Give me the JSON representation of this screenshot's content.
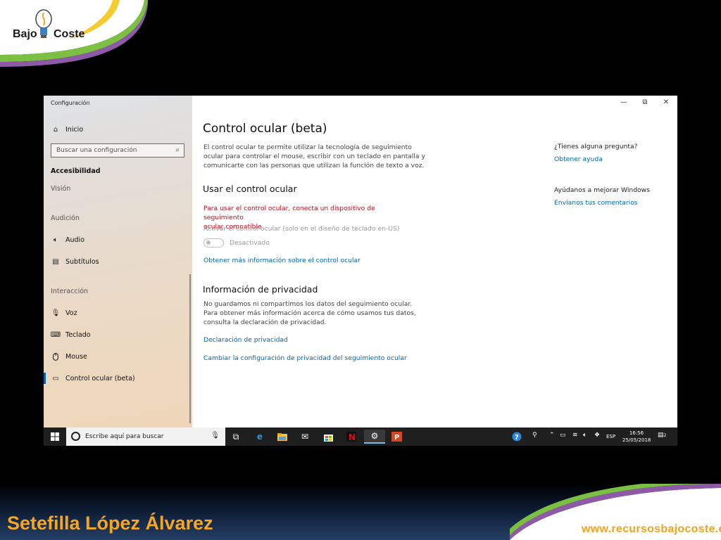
{
  "branding": {
    "logo_left": "Bajo",
    "logo_right": "Coste",
    "author": "Setefilla López Álvarez",
    "website": "www.recursosbajocoste.es"
  },
  "window": {
    "app_title": "Configuración",
    "controls": {
      "minimize": "—",
      "restore": "⧉",
      "close": "✕"
    }
  },
  "sidebar": {
    "home": "Inicio",
    "search_placeholder": "Buscar una configuración",
    "category": "Accesibilidad",
    "items": {
      "vision": "Visión",
      "audition_header": "Audición",
      "audio": "Audio",
      "subtitles": "Subtítulos",
      "interaction_header": "Interacción",
      "voice": "Voz",
      "keyboard": "Teclado",
      "mouse": "Mouse",
      "eye_control": "Control ocular (beta)"
    }
  },
  "main": {
    "title": "Control ocular (beta)",
    "intro_lines": [
      "El control ocular te permite utilizar la tecnología de seguimiento",
      "ocular para controlar el mouse, escribir con un teclado en pantalla y",
      "comunicarte con las personas que utilizan la función de texto a voz."
    ],
    "use_header": "Usar el control ocular",
    "warning_lines": [
      "Para usar el control ocular, conecta un dispositivo de seguimiento",
      "ocular compatible"
    ],
    "activate_label": "Activar el control ocular (solo en el diseño de teclado en-US)",
    "toggle_state": "Desactivado",
    "more_info_link": "Obtener más información sobre el control ocular",
    "privacy_header": "Información de privacidad",
    "privacy_lines": [
      "No guardamos ni compartimos los datos del seguimiento ocular.",
      "Para obtener más información acerca de cómo usamos tus datos,",
      "consulta la declaración de privacidad."
    ],
    "privacy_link": "Declaración de privacidad",
    "privacy_settings_link": "Cambiar la configuración de privacidad del seguimiento ocular"
  },
  "right": {
    "question": "¿Tienes alguna pregunta?",
    "help_link": "Obtener ayuda",
    "improve": "Ayúdanos a mejorar Windows",
    "feedback_link": "Envíanos tus comentarios"
  },
  "taskbar": {
    "search_placeholder": "Escribe aquí para buscar",
    "language": "ESP",
    "time": "16:56",
    "date": "25/05/2018",
    "notification_count": "2"
  },
  "colors": {
    "accent": "#0067b8",
    "warning": "#c50f1f",
    "orange_brand": "#f5a623"
  }
}
